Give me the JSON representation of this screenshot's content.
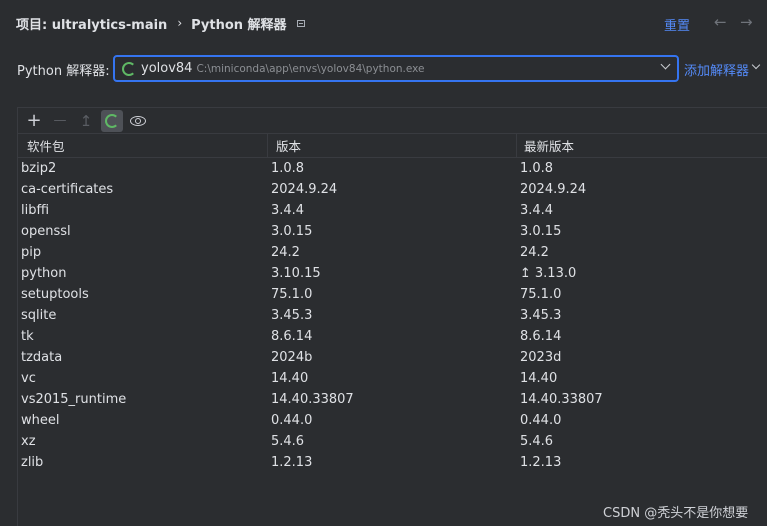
{
  "header": {
    "project_label": "项目: ultralytics-main",
    "separator": "›",
    "page_title": "Python 解释器",
    "reset_label": "重置",
    "back_arrow": "←",
    "forward_arrow": "→"
  },
  "interpreter": {
    "label": "Python 解释器:",
    "name": "yolov84",
    "path": "C:\\miniconda\\app\\envs\\yolov84\\python.exe",
    "add_label": "添加解释器"
  },
  "toolbar": {
    "add": "+",
    "remove": "—",
    "upgrade": "↥"
  },
  "table": {
    "headers": [
      "软件包",
      "版本",
      "最新版本"
    ],
    "rows": [
      {
        "name": "bzip2",
        "version": "1.0.8",
        "latest": "1.0.8",
        "upgrade": ""
      },
      {
        "name": "ca-certificates",
        "version": "2024.9.24",
        "latest": "2024.9.24",
        "upgrade": ""
      },
      {
        "name": "libffi",
        "version": "3.4.4",
        "latest": "3.4.4",
        "upgrade": ""
      },
      {
        "name": "openssl",
        "version": "3.0.15",
        "latest": "3.0.15",
        "upgrade": ""
      },
      {
        "name": "pip",
        "version": "24.2",
        "latest": "24.2",
        "upgrade": ""
      },
      {
        "name": "python",
        "version": "3.10.15",
        "latest": "3.13.0",
        "upgrade": "↥"
      },
      {
        "name": "setuptools",
        "version": "75.1.0",
        "latest": "75.1.0",
        "upgrade": ""
      },
      {
        "name": "sqlite",
        "version": "3.45.3",
        "latest": "3.45.3",
        "upgrade": ""
      },
      {
        "name": "tk",
        "version": "8.6.14",
        "latest": "8.6.14",
        "upgrade": ""
      },
      {
        "name": "tzdata",
        "version": "2024b",
        "latest": "2023d",
        "upgrade": ""
      },
      {
        "name": "vc",
        "version": "14.40",
        "latest": "14.40",
        "upgrade": ""
      },
      {
        "name": "vs2015_runtime",
        "version": "14.40.33807",
        "latest": "14.40.33807",
        "upgrade": ""
      },
      {
        "name": "wheel",
        "version": "0.44.0",
        "latest": "0.44.0",
        "upgrade": ""
      },
      {
        "name": "xz",
        "version": "5.4.6",
        "latest": "5.4.6",
        "upgrade": ""
      },
      {
        "name": "zlib",
        "version": "1.2.13",
        "latest": "1.2.13",
        "upgrade": ""
      }
    ]
  },
  "watermark": "CSDN @秃头不是你想要",
  "colors": {
    "background": "#2b2d30",
    "accent": "#3574f0",
    "link": "#548af7",
    "spinner": "#5fb865"
  }
}
